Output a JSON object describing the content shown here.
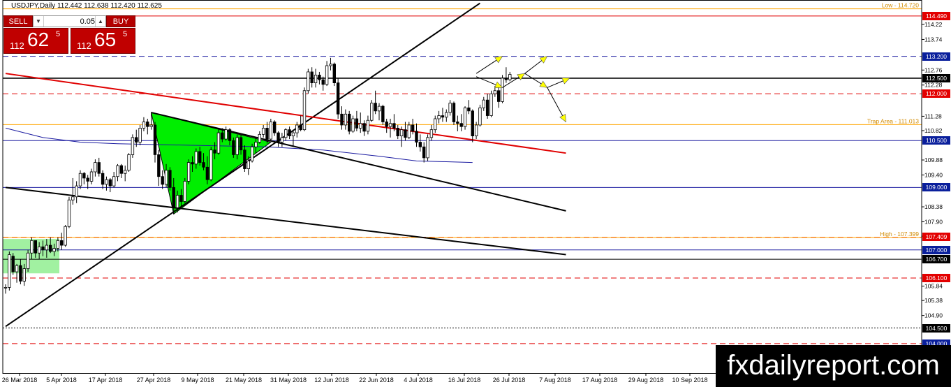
{
  "symbol_label": "USDJPY,Daily  112.442 112.638 112.420 112.625",
  "trade_panel": {
    "sell_label": "SELL",
    "buy_label": "BUY",
    "lot_value": "0.05",
    "sell_price": {
      "small": "112",
      "big": "62",
      "sup": "5"
    },
    "buy_price": {
      "small": "112",
      "big": "65",
      "sup": "5"
    }
  },
  "watermark": "fxdailyreport.com",
  "colors": {
    "tag_red": "#e30000",
    "tag_blue": "#0a1f9c",
    "tag_black": "#000000",
    "orange": "#ffa500",
    "triangle_green": "#00ee00",
    "box_green": "#90ee90",
    "trend_red": "#e00000",
    "ma_blue": "#1a1aa0",
    "arrow_yellow": "#ffff00"
  },
  "chart_data": {
    "type": "candlestick",
    "x_tick_labels": [
      "26 Mar 2018",
      "5 Apr 2018",
      "17 Apr 2018",
      "27 Apr 2018",
      "9 May 2018",
      "21 May 2018",
      "31 May 2018",
      "12 Jun 2018",
      "22 Jun 2018",
      "4 Jul 2018",
      "16 Jul 2018",
      "26 Jul 2018",
      "7 Aug 2018",
      "17 Aug 2018",
      "29 Aug 2018",
      "10 Sep 2018"
    ],
    "y_ticks": [
      114.22,
      113.74,
      112.76,
      112.28,
      111.28,
      110.82,
      109.88,
      109.4,
      108.38,
      107.9,
      107.44,
      105.84,
      105.38,
      104.9
    ],
    "ylim": [
      103.95,
      114.9
    ],
    "level_tags": [
      {
        "label": "114.490",
        "value": 114.49,
        "style": "red"
      },
      {
        "label": "113.200",
        "value": 113.2,
        "style": "blue"
      },
      {
        "label": "112.500",
        "value": 112.5,
        "style": "black"
      },
      {
        "label": "112.000",
        "value": 112.0,
        "style": "red"
      },
      {
        "label": "110.500",
        "value": 110.5,
        "style": "blue"
      },
      {
        "label": "109.000",
        "value": 109.0,
        "style": "blue"
      },
      {
        "label": "107.409",
        "value": 107.409,
        "style": "red"
      },
      {
        "label": "107.000",
        "value": 107.0,
        "style": "blue"
      },
      {
        "label": "106.700",
        "value": 106.7,
        "style": "black"
      },
      {
        "label": "106.100",
        "value": 106.1,
        "style": "red"
      },
      {
        "label": "104.500",
        "value": 104.5,
        "style": "black"
      },
      {
        "label": "104.000",
        "value": 104.0,
        "style": "blue"
      }
    ],
    "line_labels": [
      {
        "text": "Low - 114.720",
        "value": 114.72
      },
      {
        "text": "Trap Area - 111.013",
        "value": 111.013
      },
      {
        "text": "High - 107.399",
        "value": 107.399
      }
    ],
    "horizontal_lines": [
      {
        "value": 114.72,
        "color": "orange",
        "style": "solid"
      },
      {
        "value": 114.49,
        "color": "red",
        "style": "solid"
      },
      {
        "value": 113.2,
        "color": "blue",
        "style": "dashed"
      },
      {
        "value": 112.5,
        "color": "black",
        "style": "solid",
        "thick": true
      },
      {
        "value": 112.0,
        "color": "red",
        "style": "dashed"
      },
      {
        "value": 111.013,
        "color": "orange",
        "style": "solid"
      },
      {
        "value": 110.5,
        "color": "blue",
        "style": "solid"
      },
      {
        "value": 109.0,
        "color": "blue",
        "style": "solid"
      },
      {
        "value": 107.409,
        "color": "red",
        "style": "dashed"
      },
      {
        "value": 107.399,
        "color": "orange",
        "style": "solid"
      },
      {
        "value": 107.0,
        "color": "blue",
        "style": "solid"
      },
      {
        "value": 106.7,
        "color": "black",
        "style": "solid"
      },
      {
        "value": 106.1,
        "color": "red",
        "style": "dashed"
      },
      {
        "value": 104.5,
        "color": "black",
        "style": "dotted"
      },
      {
        "value": 104.0,
        "color": "red",
        "style": "dashed"
      }
    ],
    "trendlines": [
      {
        "color": "black",
        "from": {
          "bar": 0,
          "y": 104.55
        },
        "to": {
          "bar": 127,
          "y": 114.9
        }
      },
      {
        "color": "red",
        "from": {
          "bar": 0,
          "y": 112.65
        },
        "to": {
          "bar": 150,
          "y": 110.1
        }
      },
      {
        "color": "black",
        "from": {
          "bar": 0,
          "y": 109.0
        },
        "to": {
          "bar": 150,
          "y": 106.85
        }
      },
      {
        "color": "black",
        "from": {
          "bar": 39,
          "y": 111.4
        },
        "to": {
          "bar": 150,
          "y": 108.25
        }
      }
    ],
    "triangle": [
      {
        "bar": 39,
        "y": 111.4
      },
      {
        "bar": 45,
        "y": 108.15
      },
      {
        "bar": 71,
        "y": 110.45
      }
    ],
    "box": {
      "from_bar": 0,
      "to_bar": 14.4,
      "top": 107.35,
      "bottom": 106.25
    },
    "ma_line": [
      [
        0,
        110.9
      ],
      [
        10,
        110.6
      ],
      [
        20,
        110.45
      ],
      [
        30,
        110.4
      ],
      [
        50,
        110.35
      ],
      [
        70,
        110.3
      ],
      [
        85,
        110.2
      ],
      [
        100,
        110.0
      ],
      [
        110,
        109.85
      ],
      [
        125,
        109.8
      ]
    ],
    "projection_arrows": [
      [
        [
          126,
          112.65
        ],
        [
          133,
          113.2
        ]
      ],
      [
        [
          126,
          112.55
        ],
        [
          133,
          112.2
        ]
      ],
      [
        [
          133,
          112.2
        ],
        [
          139,
          112.65
        ]
      ],
      [
        [
          139,
          112.65
        ],
        [
          145,
          113.2
        ]
      ],
      [
        [
          139,
          112.65
        ],
        [
          145,
          112.2
        ]
      ],
      [
        [
          145,
          112.2
        ],
        [
          151,
          112.5
        ]
      ],
      [
        [
          145,
          112.2
        ],
        [
          150,
          111.1
        ]
      ]
    ],
    "candles": [
      [
        105.8,
        105.9,
        105.6,
        105.8
      ],
      [
        105.8,
        106.95,
        105.7,
        106.85
      ],
      [
        106.8,
        106.9,
        106.2,
        106.3
      ],
      [
        106.3,
        106.55,
        105.95,
        106.5
      ],
      [
        106.5,
        106.7,
        105.9,
        106.0
      ],
      [
        106.0,
        106.55,
        105.85,
        106.4
      ],
      [
        106.4,
        107.0,
        106.3,
        106.9
      ],
      [
        106.9,
        107.4,
        106.7,
        107.3
      ],
      [
        107.3,
        107.3,
        106.75,
        106.9
      ],
      [
        106.9,
        107.25,
        106.7,
        107.1
      ],
      [
        107.1,
        107.3,
        106.8,
        107.0
      ],
      [
        107.0,
        107.35,
        106.75,
        107.15
      ],
      [
        107.15,
        107.4,
        106.9,
        106.95
      ],
      [
        106.95,
        107.2,
        106.8,
        107.05
      ],
      [
        107.05,
        107.4,
        106.95,
        107.3
      ],
      [
        107.3,
        107.55,
        107.0,
        107.15
      ],
      [
        107.15,
        107.8,
        107.1,
        107.75
      ],
      [
        107.75,
        108.7,
        107.7,
        108.6
      ],
      [
        108.6,
        109.3,
        108.45,
        108.7
      ],
      [
        108.7,
        109.2,
        108.5,
        109.05
      ],
      [
        109.05,
        109.55,
        108.95,
        109.45
      ],
      [
        109.45,
        109.5,
        109.1,
        109.3
      ],
      [
        109.3,
        109.4,
        108.95,
        109.2
      ],
      [
        109.2,
        109.6,
        109.1,
        109.5
      ],
      [
        109.5,
        109.9,
        109.35,
        109.8
      ],
      [
        109.8,
        109.95,
        109.35,
        109.45
      ],
      [
        109.45,
        109.55,
        108.95,
        109.1
      ],
      [
        109.1,
        109.35,
        108.9,
        109.25
      ],
      [
        109.25,
        109.3,
        108.85,
        109.05
      ],
      [
        109.05,
        109.5,
        109.0,
        109.35
      ],
      [
        109.35,
        109.75,
        109.2,
        109.7
      ],
      [
        109.7,
        109.75,
        109.3,
        109.45
      ],
      [
        109.45,
        109.7,
        109.2,
        109.55
      ],
      [
        109.55,
        110.1,
        109.5,
        110.05
      ],
      [
        110.05,
        110.7,
        109.95,
        110.6
      ],
      [
        110.6,
        110.85,
        110.3,
        110.45
      ],
      [
        110.45,
        111.0,
        110.35,
        110.9
      ],
      [
        110.9,
        111.25,
        110.8,
        111.1
      ],
      [
        111.1,
        111.2,
        110.7,
        110.95
      ],
      [
        110.95,
        111.4,
        110.85,
        111.0
      ],
      [
        111.0,
        111.1,
        109.8,
        110.05
      ],
      [
        110.05,
        110.2,
        109.05,
        109.35
      ],
      [
        109.35,
        109.55,
        108.95,
        109.1
      ],
      [
        109.1,
        109.75,
        109.0,
        109.55
      ],
      [
        109.55,
        109.65,
        108.9,
        109.0
      ],
      [
        109.0,
        109.3,
        108.15,
        108.35
      ],
      [
        108.35,
        108.9,
        108.2,
        108.75
      ],
      [
        108.75,
        108.95,
        108.4,
        108.55
      ],
      [
        108.55,
        109.3,
        108.5,
        109.2
      ],
      [
        109.2,
        109.9,
        109.1,
        109.8
      ],
      [
        109.8,
        110.0,
        109.5,
        109.75
      ],
      [
        109.75,
        110.25,
        109.6,
        110.15
      ],
      [
        110.15,
        110.3,
        109.7,
        109.8
      ],
      [
        109.8,
        110.1,
        109.55,
        109.65
      ],
      [
        109.65,
        110.0,
        109.1,
        109.25
      ],
      [
        109.25,
        110.3,
        109.2,
        110.2
      ],
      [
        110.2,
        110.45,
        109.9,
        110.1
      ],
      [
        110.1,
        110.85,
        110.05,
        110.75
      ],
      [
        110.75,
        110.9,
        110.45,
        110.55
      ],
      [
        110.55,
        110.95,
        110.5,
        110.85
      ],
      [
        110.85,
        110.9,
        110.35,
        110.5
      ],
      [
        110.5,
        110.6,
        109.95,
        110.05
      ],
      [
        110.05,
        110.7,
        109.9,
        110.6
      ],
      [
        110.6,
        110.7,
        110.05,
        110.2
      ],
      [
        110.2,
        110.35,
        109.5,
        109.6
      ],
      [
        109.6,
        110.0,
        109.4,
        109.85
      ],
      [
        109.85,
        110.4,
        109.8,
        110.3
      ],
      [
        110.3,
        110.6,
        110.1,
        110.45
      ],
      [
        110.45,
        110.8,
        110.4,
        110.7
      ],
      [
        110.7,
        111.0,
        110.6,
        110.9
      ],
      [
        110.9,
        111.1,
        110.4,
        110.55
      ],
      [
        110.55,
        111.2,
        110.5,
        111.1
      ],
      [
        111.1,
        111.15,
        110.65,
        110.75
      ],
      [
        110.75,
        110.8,
        110.3,
        110.45
      ],
      [
        110.45,
        110.75,
        110.3,
        110.6
      ],
      [
        110.6,
        110.9,
        110.5,
        110.85
      ],
      [
        110.85,
        110.95,
        110.55,
        110.65
      ],
      [
        110.65,
        110.85,
        110.3,
        110.75
      ],
      [
        110.75,
        111.1,
        110.6,
        111.0
      ],
      [
        111.0,
        111.3,
        110.8,
        110.85
      ],
      [
        110.85,
        112.2,
        110.8,
        112.1
      ],
      [
        112.1,
        112.8,
        112.0,
        112.7
      ],
      [
        112.7,
        112.85,
        112.2,
        112.35
      ],
      [
        112.35,
        112.8,
        112.2,
        112.6
      ],
      [
        112.6,
        112.7,
        112.3,
        112.45
      ],
      [
        112.45,
        112.55,
        112.1,
        112.3
      ],
      [
        112.3,
        113.05,
        112.25,
        112.9
      ],
      [
        112.9,
        113.15,
        112.75,
        112.95
      ],
      [
        112.95,
        113.0,
        112.25,
        112.35
      ],
      [
        112.35,
        112.5,
        111.2,
        111.35
      ],
      [
        111.35,
        111.6,
        110.85,
        111.0
      ],
      [
        111.0,
        111.5,
        110.85,
        111.35
      ],
      [
        111.35,
        111.45,
        110.7,
        110.8
      ],
      [
        110.8,
        111.3,
        110.75,
        111.2
      ],
      [
        111.2,
        111.45,
        110.8,
        110.9
      ],
      [
        110.9,
        111.4,
        110.75,
        111.05
      ],
      [
        111.05,
        111.15,
        110.65,
        110.8
      ],
      [
        110.8,
        111.3,
        110.7,
        111.15
      ],
      [
        111.15,
        111.8,
        111.1,
        111.7
      ],
      [
        111.7,
        112.1,
        111.35,
        111.45
      ],
      [
        111.45,
        111.7,
        111.15,
        111.6
      ],
      [
        111.6,
        111.65,
        111.0,
        111.1
      ],
      [
        111.1,
        111.2,
        110.75,
        110.95
      ],
      [
        110.95,
        111.2,
        110.6,
        111.05
      ],
      [
        111.05,
        111.35,
        110.8,
        110.9
      ],
      [
        110.9,
        111.0,
        110.55,
        110.65
      ],
      [
        110.65,
        110.95,
        110.3,
        110.85
      ],
      [
        110.85,
        111.1,
        110.5,
        110.6
      ],
      [
        110.6,
        111.1,
        110.55,
        111.0
      ],
      [
        111.0,
        111.2,
        110.7,
        110.8
      ],
      [
        110.8,
        111.05,
        110.3,
        110.45
      ],
      [
        110.45,
        110.7,
        110.15,
        110.3
      ],
      [
        110.3,
        110.45,
        109.8,
        109.95
      ],
      [
        109.95,
        110.7,
        109.85,
        110.6
      ],
      [
        110.6,
        111.0,
        110.5,
        110.85
      ],
      [
        110.85,
        111.3,
        110.75,
        111.2
      ],
      [
        111.2,
        111.45,
        111.05,
        111.3
      ],
      [
        111.3,
        111.55,
        111.1,
        111.25
      ],
      [
        111.25,
        111.5,
        111.1,
        111.4
      ],
      [
        111.4,
        111.8,
        111.3,
        111.7
      ],
      [
        111.7,
        111.75,
        111.0,
        111.1
      ],
      [
        111.1,
        111.3,
        110.8,
        111.05
      ],
      [
        111.05,
        111.35,
        110.8,
        110.95
      ],
      [
        110.95,
        111.6,
        110.85,
        111.55
      ],
      [
        111.55,
        111.8,
        111.35,
        111.45
      ],
      [
        111.45,
        111.5,
        110.45,
        110.65
      ],
      [
        110.65,
        111.1,
        110.55,
        111.0
      ],
      [
        111.0,
        111.65,
        110.95,
        111.55
      ],
      [
        111.55,
        111.9,
        111.45,
        111.8
      ],
      [
        111.8,
        112.0,
        111.2,
        111.3
      ],
      [
        111.3,
        112.1,
        111.25,
        112.0
      ],
      [
        112.0,
        112.25,
        111.9,
        112.1
      ],
      [
        112.1,
        112.2,
        111.55,
        111.75
      ],
      [
        111.75,
        112.6,
        111.7,
        112.5
      ],
      [
        112.5,
        112.85,
        112.35,
        112.45
      ],
      [
        112.45,
        112.7,
        112.4,
        112.62
      ]
    ]
  }
}
